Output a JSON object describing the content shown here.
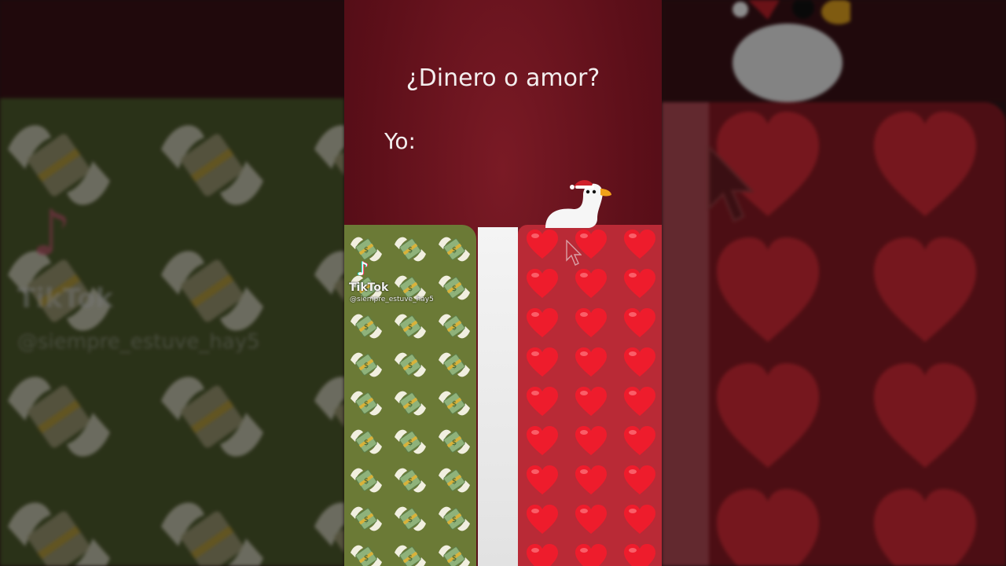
{
  "video": {
    "question": "¿Dinero o amor?",
    "answer_label": "Yo:"
  },
  "watermark": {
    "logo_icon": "tiktok-logo-icon",
    "name": "TikTok",
    "handle": "@siempre_estuve_hay5"
  },
  "panels": {
    "money_emoji": "money-with-wings-icon",
    "heart_emoji": "red-heart-icon"
  },
  "colors": {
    "background": "#5c0f19",
    "money_panel": "#6b7a36",
    "heart_panel": "#b92a36",
    "divider": "#f4f4f4"
  }
}
